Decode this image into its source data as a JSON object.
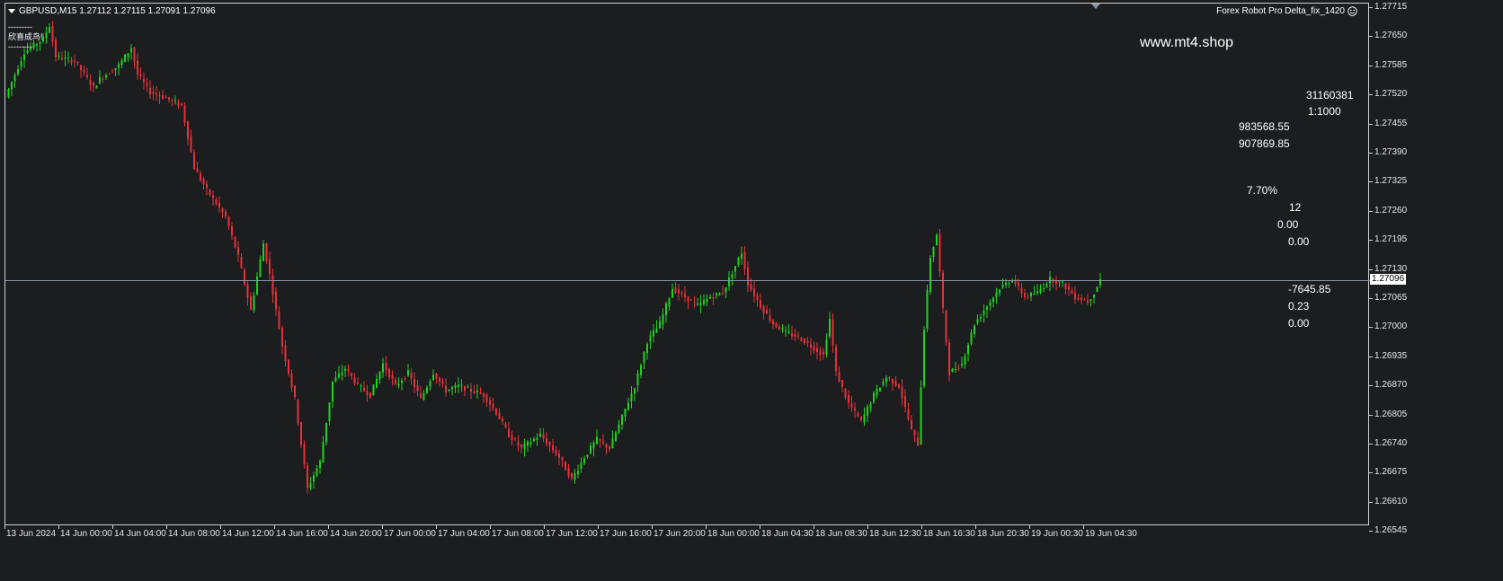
{
  "header": {
    "symbol_line": "GBPUSD,M15  1.27112 1.27115 1.27091 1.27096",
    "ea_name": "Forex Robot Pro Delta_fix_1420",
    "status_dashes_top": "---------",
    "status_text": "欣喜成鸟!",
    "status_dashes_bottom": "---------"
  },
  "website": "www.mt4.shop",
  "account_panel": {
    "account_number": "31160381",
    "leverage": "1:1000",
    "balance": "983568.55",
    "equity": "907869.85",
    "percent": "7.70%",
    "orders": "12",
    "value_a": "0.00",
    "value_b": "0.00",
    "profit": "-7645.85",
    "lots": "0.23",
    "value_c": "0.00"
  },
  "current_price": "1.27096",
  "price_axis": [
    "1.27715",
    "1.27650",
    "1.27585",
    "1.27520",
    "1.27455",
    "1.27390",
    "1.27325",
    "1.27260",
    "1.27195",
    "1.27130",
    "1.27065",
    "1.27000",
    "1.26935",
    "1.26870",
    "1.26805",
    "1.26740",
    "1.26675",
    "1.26610",
    "1.26545"
  ],
  "time_axis": [
    "13 Jun 2024",
    "14 Jun 00:00",
    "14 Jun 04:00",
    "14 Jun 08:00",
    "14 Jun 12:00",
    "14 Jun 16:00",
    "14 Jun 20:00",
    "17 Jun 00:00",
    "17 Jun 04:00",
    "17 Jun 08:00",
    "17 Jun 12:00",
    "17 Jun 16:00",
    "17 Jun 20:00",
    "18 Jun 00:00",
    "18 Jun 04:30",
    "18 Jun 08:30",
    "18 Jun 12:30",
    "18 Jun 16:30",
    "18 Jun 20:30",
    "19 Jun 00:30",
    "19 Jun 04:30"
  ],
  "colors": {
    "background": "#1b1d1f",
    "bull": "#1fd31f",
    "bear": "#e8303a",
    "bid_line": "#8a95a8"
  },
  "chart_data": {
    "type": "candlestick",
    "symbol": "GBPUSD",
    "timeframe": "M15",
    "ylim": [
      1.26545,
      1.27715
    ],
    "anchors": [
      [
        0,
        1.2751
      ],
      [
        6,
        1.2761
      ],
      [
        12,
        1.2764
      ],
      [
        14,
        1.2767
      ],
      [
        16,
        1.276
      ],
      [
        22,
        1.2759
      ],
      [
        28,
        1.2753
      ],
      [
        30,
        1.2755
      ],
      [
        36,
        1.2758
      ],
      [
        40,
        1.2762
      ],
      [
        42,
        1.2756
      ],
      [
        46,
        1.2752
      ],
      [
        50,
        1.2751
      ],
      [
        56,
        1.2749
      ],
      [
        60,
        1.2735
      ],
      [
        64,
        1.273
      ],
      [
        70,
        1.2724
      ],
      [
        74,
        1.2715
      ],
      [
        78,
        1.2703
      ],
      [
        82,
        1.2718
      ],
      [
        84,
        1.2711
      ],
      [
        88,
        1.2695
      ],
      [
        92,
        1.2683
      ],
      [
        96,
        1.2663
      ],
      [
        100,
        1.2669
      ],
      [
        104,
        1.2687
      ],
      [
        108,
        1.269
      ],
      [
        112,
        1.2686
      ],
      [
        116,
        1.2684
      ],
      [
        120,
        1.2691
      ],
      [
        124,
        1.2686
      ],
      [
        128,
        1.2689
      ],
      [
        132,
        1.2683
      ],
      [
        136,
        1.2689
      ],
      [
        140,
        1.2685
      ],
      [
        144,
        1.2686
      ],
      [
        148,
        1.2685
      ],
      [
        152,
        1.2684
      ],
      [
        156,
        1.268
      ],
      [
        160,
        1.2675
      ],
      [
        164,
        1.2672
      ],
      [
        170,
        1.2675
      ],
      [
        176,
        1.267
      ],
      [
        180,
        1.2665
      ],
      [
        184,
        1.267
      ],
      [
        188,
        1.2674
      ],
      [
        192,
        1.2672
      ],
      [
        196,
        1.2679
      ],
      [
        200,
        1.2686
      ],
      [
        204,
        1.2696
      ],
      [
        208,
        1.27
      ],
      [
        212,
        1.2708
      ],
      [
        216,
        1.2706
      ],
      [
        220,
        1.2704
      ],
      [
        224,
        1.2706
      ],
      [
        228,
        1.2707
      ],
      [
        232,
        1.2713
      ],
      [
        234,
        1.2716
      ],
      [
        236,
        1.2709
      ],
      [
        240,
        1.2704
      ],
      [
        244,
        1.27
      ],
      [
        248,
        1.2698
      ],
      [
        252,
        1.2697
      ],
      [
        256,
        1.2695
      ],
      [
        260,
        1.2693
      ],
      [
        262,
        1.2701
      ],
      [
        264,
        1.2689
      ],
      [
        268,
        1.2682
      ],
      [
        272,
        1.2678
      ],
      [
        276,
        1.2684
      ],
      [
        280,
        1.2688
      ],
      [
        284,
        1.2686
      ],
      [
        288,
        1.2676
      ],
      [
        290,
        1.2673
      ],
      [
        292,
        1.2699
      ],
      [
        294,
        1.2715
      ],
      [
        296,
        1.272
      ],
      [
        298,
        1.2703
      ],
      [
        300,
        1.2689
      ],
      [
        304,
        1.2691
      ],
      [
        308,
        1.27
      ],
      [
        312,
        1.2704
      ],
      [
        316,
        1.2708
      ],
      [
        320,
        1.271
      ],
      [
        324,
        1.2706
      ],
      [
        328,
        1.2707
      ],
      [
        332,
        1.271
      ],
      [
        336,
        1.2709
      ],
      [
        340,
        1.2706
      ],
      [
        344,
        1.2705
      ],
      [
        346,
        1.2707
      ],
      [
        348,
        1.271
      ]
    ]
  }
}
